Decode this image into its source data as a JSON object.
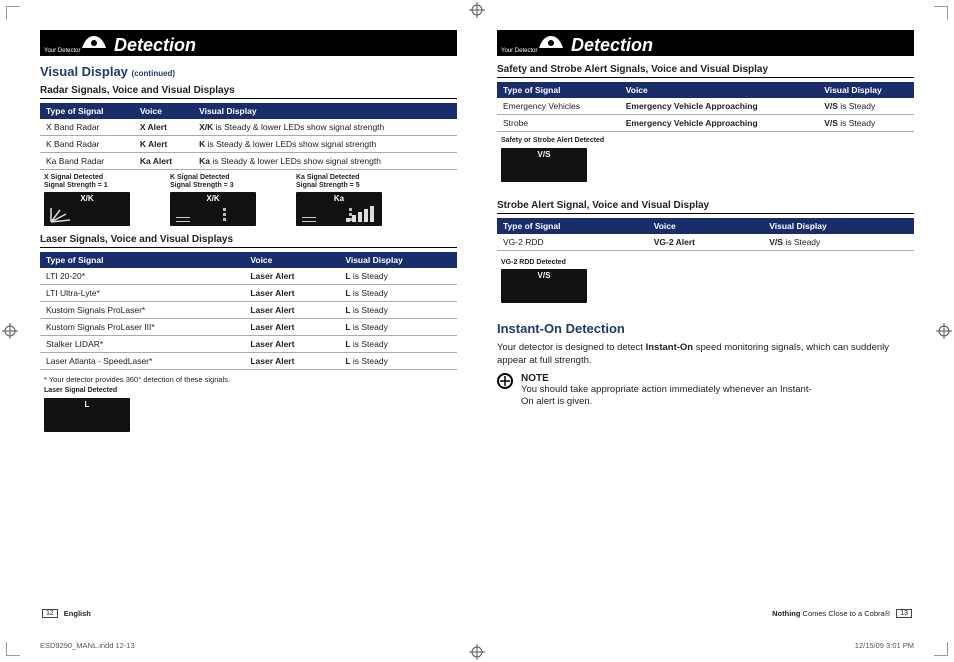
{
  "bar": {
    "brand": "Your Detector",
    "title_left": "Detection",
    "title_right": "Detection"
  },
  "left": {
    "visual_display": "Visual Display",
    "continued": "(continued)",
    "radar_sub": "Radar Signals, Voice and Visual Displays",
    "th_signal": "Type of Signal",
    "th_voice": "Voice",
    "th_vd": "Visual Display",
    "radar_rows": [
      {
        "s": "X Band Radar",
        "v": "X Alert",
        "d_b": "X/K",
        "d_t": " is Steady & lower LEDs show signal strength"
      },
      {
        "s": "K Band Radar",
        "v": "K Alert",
        "d_b": "K",
        "d_t": " is Steady & lower LEDs show signal strength"
      },
      {
        "s": "Ka Band Radar",
        "v": "Ka Alert",
        "d_b": "Ka",
        "d_t": " is Steady & lower LEDs show signal strength"
      }
    ],
    "diag_x_l1": "X Signal Detected",
    "diag_x_l2": "Signal Strength = 1",
    "diag_k_l1": "K Signal Detected",
    "diag_k_l2": "Signal Strength = 3",
    "diag_ka_l1": "Ka Signal Detected",
    "diag_ka_l2": "Signal Strength = 5",
    "lcd_xk": "X/K",
    "lcd_ka": "Ka",
    "laser_sub": "Laser Signals, Voice and Visual Displays",
    "laser_rows": [
      {
        "s": "LTI 20-20*",
        "v": "Laser Alert",
        "d_b": "L",
        "d_t": " is Steady"
      },
      {
        "s": "LTI Ultra-Lyte*",
        "v": "Laser Alert",
        "d_b": "L",
        "d_t": " is Steady"
      },
      {
        "s": "Kustom Signals ProLaser*",
        "v": "Laser Alert",
        "d_b": "L",
        "d_t": " is Steady"
      },
      {
        "s": "Kustom Signals ProLaser III*",
        "v": "Laser Alert",
        "d_b": "L",
        "d_t": " is Steady"
      },
      {
        "s": "Stalker LIDAR*",
        "v": "Laser Alert",
        "d_b": "L",
        "d_t": " is Steady"
      },
      {
        "s": "Laser Atlanta - SpeedLaser*",
        "v": "Laser Alert",
        "d_b": "L",
        "d_t": " is Steady"
      }
    ],
    "laser_foot": "* Your detector provides 360° detection of these signals.",
    "laser_diag": "Laser Signal Detected",
    "lcd_l": "L",
    "pg": "12",
    "pg_lang": "English"
  },
  "right": {
    "safety_sub": "Safety and Strobe Alert Signals, Voice and Visual Display",
    "safety_rows": [
      {
        "s": "Emergency Vehicles",
        "v": "Emergency Vehicle Approaching",
        "d_b": "V/S",
        "d_t": " is Steady"
      },
      {
        "s": "Strobe",
        "v": "Emergency Vehicle Approaching",
        "d_b": "V/S",
        "d_t": " is Steady"
      }
    ],
    "safety_diag": "Safety or Strobe Alert Detected",
    "lcd_vs": "V/S",
    "strobe_sub": "Strobe Alert Signal, Voice and Visual Display",
    "strobe_rows": [
      {
        "s": "VG-2 RDD",
        "v": "VG-2 Alert",
        "d_b": "V/S",
        "d_t": " is Steady"
      }
    ],
    "vg2_diag": "VG-2 RDD Detected",
    "instant_title": "Instant-On Detection",
    "instant_p1a": "Your detector is designed to detect ",
    "instant_p1b": "Instant-On",
    "instant_p1c": " speed monitoring signals, which can suddenly appear at full strength.",
    "note_head": "NOTE",
    "note_text": "You should take appropriate action immediately whenever an Instant-On alert is given.",
    "tag_a": "Nothing",
    "tag_b": " Comes Close to a Cobra",
    "tag_c": "®",
    "pg": "13"
  },
  "slug": {
    "file": "ESD9290_MANL.indd   12-13",
    "ts": "12/15/09   3:01 PM"
  },
  "th": {
    "signal": "Type of Signal",
    "voice": "Voice",
    "vd": "Visual Display"
  }
}
